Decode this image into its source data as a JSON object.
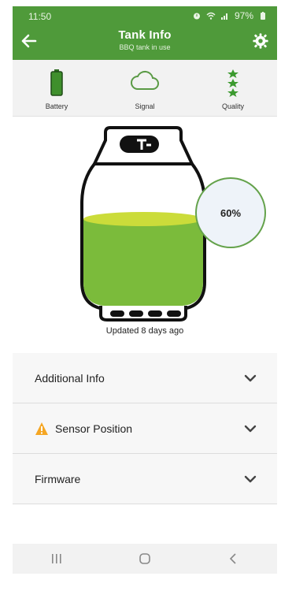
{
  "status": {
    "time": "11:50",
    "battery": "97%"
  },
  "header": {
    "title": "Tank Info",
    "subtitle": "BBQ tank in use"
  },
  "indicators": [
    {
      "label": "Battery",
      "icon": "battery-icon"
    },
    {
      "label": "Signal",
      "icon": "cloud-icon"
    },
    {
      "label": "Quality",
      "icon": "stars-icon"
    }
  ],
  "tank": {
    "level_percent_text": "60%",
    "level_fraction": 0.6,
    "updated_text": "Updated 8 days ago"
  },
  "accordion": {
    "items": [
      {
        "title": "Additional Info"
      },
      {
        "title": "Sensor Position",
        "warning": true
      },
      {
        "title": "Firmware"
      }
    ]
  },
  "colors": {
    "header": "#4f9a3a",
    "tank_fill": "#7bbb3b",
    "tank_top": "#cbdc3a",
    "badge_ring": "#64a24b",
    "warning": "#f5a623"
  }
}
